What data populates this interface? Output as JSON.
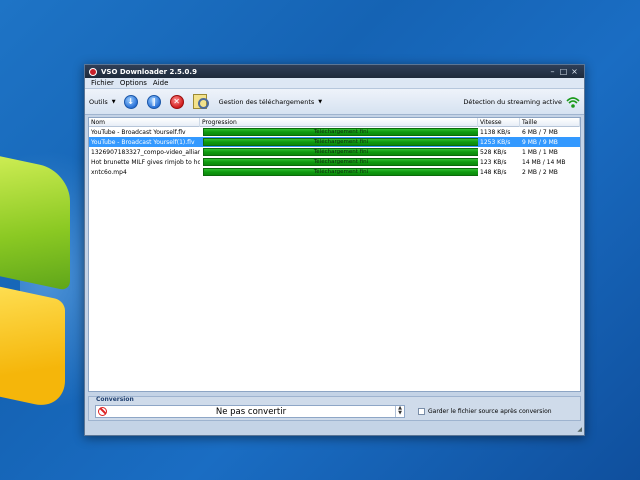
{
  "window": {
    "title": "VSO Downloader 2.5.0.9",
    "controls": {
      "minimize": "–",
      "restore": "□",
      "close": "×"
    }
  },
  "menu": [
    "Fichier",
    "Options",
    "Aide"
  ],
  "toolbar": {
    "tools_label": "Outils",
    "manage_label": "Gestion des téléchargements",
    "streaming_label": "Détection du streaming active"
  },
  "list": {
    "headers": {
      "name": "Nom",
      "progress": "Progression",
      "speed": "Vitesse",
      "size": "Taille"
    },
    "rows": [
      {
        "name": "YouTube - Broadcast Yourself.flv",
        "progress": "Téléchargement fini",
        "speed": "1138 KB/s",
        "size": "6 MB / 7 MB",
        "selected": false
      },
      {
        "name": "YouTube - Broadcast Yourself(1).flv",
        "progress": "Téléchargement fini",
        "speed": "1253 KB/s",
        "size": "9 MB / 9 MB",
        "selected": true
      },
      {
        "name": "1326907183327_compo-video_allianz...",
        "progress": "Téléchargement fini",
        "speed": "528 KB/s",
        "size": "1 MB / 1 MB",
        "selected": false
      },
      {
        "name": "Hot brunette MILF gives rimjob to hor...",
        "progress": "Téléchargement fini",
        "speed": "123 KB/s",
        "size": "14 MB / 14 MB",
        "selected": false
      },
      {
        "name": "xntc6o.mp4",
        "progress": "Téléchargement fini",
        "speed": "148 KB/s",
        "size": "2 MB / 2 MB",
        "selected": false
      }
    ]
  },
  "conversion": {
    "title": "Conversion",
    "value": "Ne pas convertir",
    "keep_source_label": "Garder le fichier source après conversion"
  },
  "colors": {
    "progress_fill": "#0f9a0f",
    "selected_row": "#3399ff"
  }
}
